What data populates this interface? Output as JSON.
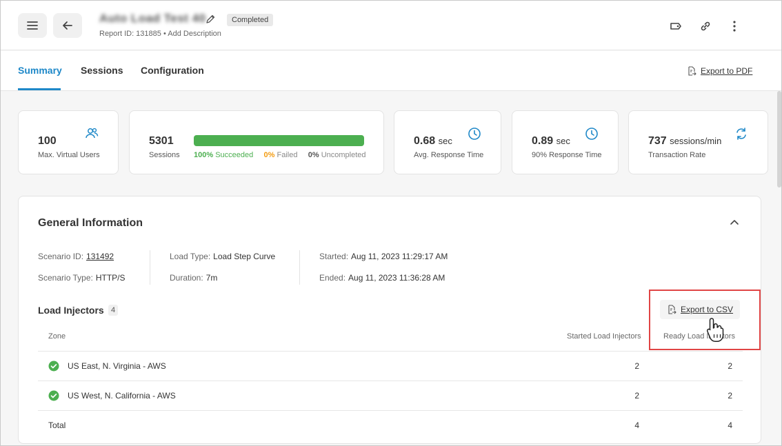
{
  "header": {
    "title": "Auto Load Test 40",
    "status": "Completed",
    "report_id": "Report ID: 131885",
    "separator": "•",
    "add_description": "Add Description"
  },
  "tabs": [
    {
      "label": "Summary",
      "active": true
    },
    {
      "label": "Sessions",
      "active": false
    },
    {
      "label": "Configuration",
      "active": false
    }
  ],
  "export_pdf": "Export to PDF",
  "stats": {
    "users": {
      "value": "100",
      "label": "Max. Virtual Users"
    },
    "sessions": {
      "value": "5301",
      "label": "Sessions",
      "succeeded_pct": "100%",
      "succeeded_label": "Succeeded",
      "failed_pct": "0%",
      "failed_label": "Failed",
      "uncompleted_pct": "0%",
      "uncompleted_label": "Uncompleted",
      "success_fraction": 1.0
    },
    "avg_response": {
      "value": "0.68",
      "unit": "sec",
      "label": "Avg. Response Time"
    },
    "p90_response": {
      "value": "0.89",
      "unit": "sec",
      "label": "90% Response Time"
    },
    "transaction_rate": {
      "value": "737",
      "unit": "sessions/min",
      "label": "Transaction Rate"
    }
  },
  "general": {
    "title": "General Information",
    "scenario_id_label": "Scenario ID:",
    "scenario_id": "131492",
    "scenario_type_label": "Scenario Type:",
    "scenario_type": "HTTP/S",
    "load_type_label": "Load Type:",
    "load_type": "Load Step Curve",
    "duration_label": "Duration:",
    "duration": "7m",
    "started_label": "Started:",
    "started": "Aug 11, 2023 11:29:17 AM",
    "ended_label": "Ended:",
    "ended": "Aug 11, 2023 11:36:28 AM"
  },
  "injectors": {
    "title": "Load Injectors",
    "count": "4",
    "export_csv": "Export to CSV",
    "columns": [
      "Zone",
      "Started Load Injectors",
      "Ready Load Injectors"
    ],
    "rows": [
      {
        "zone": "US East, N. Virginia - AWS",
        "started": "2",
        "ready": "2"
      },
      {
        "zone": "US West, N. California - AWS",
        "started": "2",
        "ready": "2"
      }
    ],
    "total": {
      "label": "Total",
      "started": "4",
      "ready": "4"
    }
  },
  "colors": {
    "accent": "#1e88c8",
    "success": "#4caf50",
    "warning": "#f39c12",
    "highlight": "#e04444"
  }
}
